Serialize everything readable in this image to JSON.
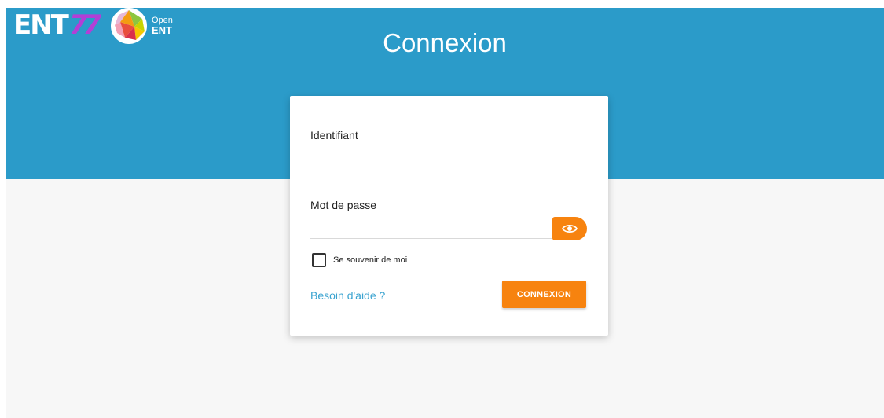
{
  "header": {
    "title": "Connexion",
    "logo_ent_text": "ENT",
    "logo_ent_number": "77",
    "logo_open_line1": "Open",
    "logo_open_line2": "ENT",
    "background_color": "#2b9bc9"
  },
  "form": {
    "username_label": "Identifiant",
    "username_value": "",
    "password_label": "Mot de passe",
    "password_value": "",
    "show_password_icon": "eye-icon",
    "remember_label": "Se souvenir de moi",
    "remember_checked": false,
    "help_link": "Besoin d'aide ?",
    "submit_label": "CONNEXION",
    "accent_color": "#f7830f",
    "link_color": "#3aa3d0"
  }
}
